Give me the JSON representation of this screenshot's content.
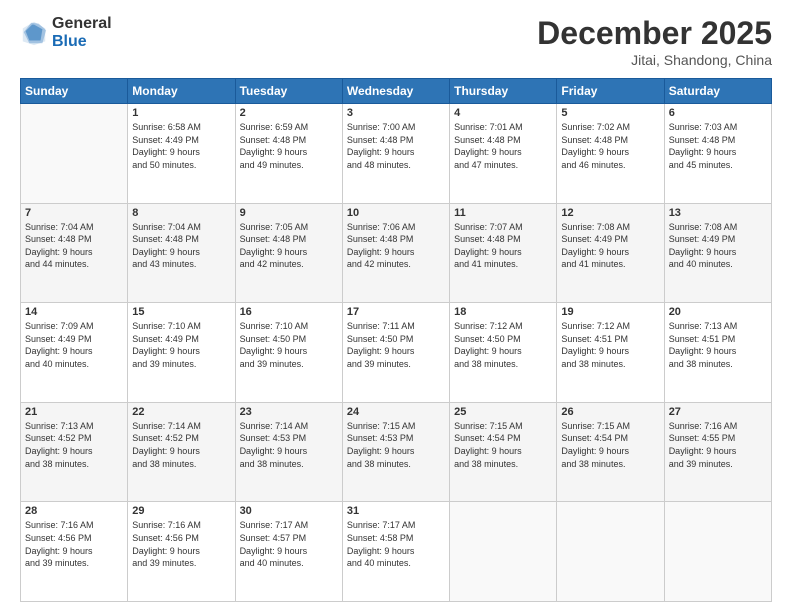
{
  "header": {
    "logo_general": "General",
    "logo_blue": "Blue",
    "title": "December 2025",
    "location": "Jitai, Shandong, China"
  },
  "days_of_week": [
    "Sunday",
    "Monday",
    "Tuesday",
    "Wednesday",
    "Thursday",
    "Friday",
    "Saturday"
  ],
  "weeks": [
    [
      {
        "day": "",
        "info": ""
      },
      {
        "day": "1",
        "info": "Sunrise: 6:58 AM\nSunset: 4:49 PM\nDaylight: 9 hours\nand 50 minutes."
      },
      {
        "day": "2",
        "info": "Sunrise: 6:59 AM\nSunset: 4:48 PM\nDaylight: 9 hours\nand 49 minutes."
      },
      {
        "day": "3",
        "info": "Sunrise: 7:00 AM\nSunset: 4:48 PM\nDaylight: 9 hours\nand 48 minutes."
      },
      {
        "day": "4",
        "info": "Sunrise: 7:01 AM\nSunset: 4:48 PM\nDaylight: 9 hours\nand 47 minutes."
      },
      {
        "day": "5",
        "info": "Sunrise: 7:02 AM\nSunset: 4:48 PM\nDaylight: 9 hours\nand 46 minutes."
      },
      {
        "day": "6",
        "info": "Sunrise: 7:03 AM\nSunset: 4:48 PM\nDaylight: 9 hours\nand 45 minutes."
      }
    ],
    [
      {
        "day": "7",
        "info": "Sunrise: 7:04 AM\nSunset: 4:48 PM\nDaylight: 9 hours\nand 44 minutes."
      },
      {
        "day": "8",
        "info": "Sunrise: 7:04 AM\nSunset: 4:48 PM\nDaylight: 9 hours\nand 43 minutes."
      },
      {
        "day": "9",
        "info": "Sunrise: 7:05 AM\nSunset: 4:48 PM\nDaylight: 9 hours\nand 42 minutes."
      },
      {
        "day": "10",
        "info": "Sunrise: 7:06 AM\nSunset: 4:48 PM\nDaylight: 9 hours\nand 42 minutes."
      },
      {
        "day": "11",
        "info": "Sunrise: 7:07 AM\nSunset: 4:48 PM\nDaylight: 9 hours\nand 41 minutes."
      },
      {
        "day": "12",
        "info": "Sunrise: 7:08 AM\nSunset: 4:49 PM\nDaylight: 9 hours\nand 41 minutes."
      },
      {
        "day": "13",
        "info": "Sunrise: 7:08 AM\nSunset: 4:49 PM\nDaylight: 9 hours\nand 40 minutes."
      }
    ],
    [
      {
        "day": "14",
        "info": "Sunrise: 7:09 AM\nSunset: 4:49 PM\nDaylight: 9 hours\nand 40 minutes."
      },
      {
        "day": "15",
        "info": "Sunrise: 7:10 AM\nSunset: 4:49 PM\nDaylight: 9 hours\nand 39 minutes."
      },
      {
        "day": "16",
        "info": "Sunrise: 7:10 AM\nSunset: 4:50 PM\nDaylight: 9 hours\nand 39 minutes."
      },
      {
        "day": "17",
        "info": "Sunrise: 7:11 AM\nSunset: 4:50 PM\nDaylight: 9 hours\nand 39 minutes."
      },
      {
        "day": "18",
        "info": "Sunrise: 7:12 AM\nSunset: 4:50 PM\nDaylight: 9 hours\nand 38 minutes."
      },
      {
        "day": "19",
        "info": "Sunrise: 7:12 AM\nSunset: 4:51 PM\nDaylight: 9 hours\nand 38 minutes."
      },
      {
        "day": "20",
        "info": "Sunrise: 7:13 AM\nSunset: 4:51 PM\nDaylight: 9 hours\nand 38 minutes."
      }
    ],
    [
      {
        "day": "21",
        "info": "Sunrise: 7:13 AM\nSunset: 4:52 PM\nDaylight: 9 hours\nand 38 minutes."
      },
      {
        "day": "22",
        "info": "Sunrise: 7:14 AM\nSunset: 4:52 PM\nDaylight: 9 hours\nand 38 minutes."
      },
      {
        "day": "23",
        "info": "Sunrise: 7:14 AM\nSunset: 4:53 PM\nDaylight: 9 hours\nand 38 minutes."
      },
      {
        "day": "24",
        "info": "Sunrise: 7:15 AM\nSunset: 4:53 PM\nDaylight: 9 hours\nand 38 minutes."
      },
      {
        "day": "25",
        "info": "Sunrise: 7:15 AM\nSunset: 4:54 PM\nDaylight: 9 hours\nand 38 minutes."
      },
      {
        "day": "26",
        "info": "Sunrise: 7:15 AM\nSunset: 4:54 PM\nDaylight: 9 hours\nand 38 minutes."
      },
      {
        "day": "27",
        "info": "Sunrise: 7:16 AM\nSunset: 4:55 PM\nDaylight: 9 hours\nand 39 minutes."
      }
    ],
    [
      {
        "day": "28",
        "info": "Sunrise: 7:16 AM\nSunset: 4:56 PM\nDaylight: 9 hours\nand 39 minutes."
      },
      {
        "day": "29",
        "info": "Sunrise: 7:16 AM\nSunset: 4:56 PM\nDaylight: 9 hours\nand 39 minutes."
      },
      {
        "day": "30",
        "info": "Sunrise: 7:17 AM\nSunset: 4:57 PM\nDaylight: 9 hours\nand 40 minutes."
      },
      {
        "day": "31",
        "info": "Sunrise: 7:17 AM\nSunset: 4:58 PM\nDaylight: 9 hours\nand 40 minutes."
      },
      {
        "day": "",
        "info": ""
      },
      {
        "day": "",
        "info": ""
      },
      {
        "day": "",
        "info": ""
      }
    ]
  ]
}
